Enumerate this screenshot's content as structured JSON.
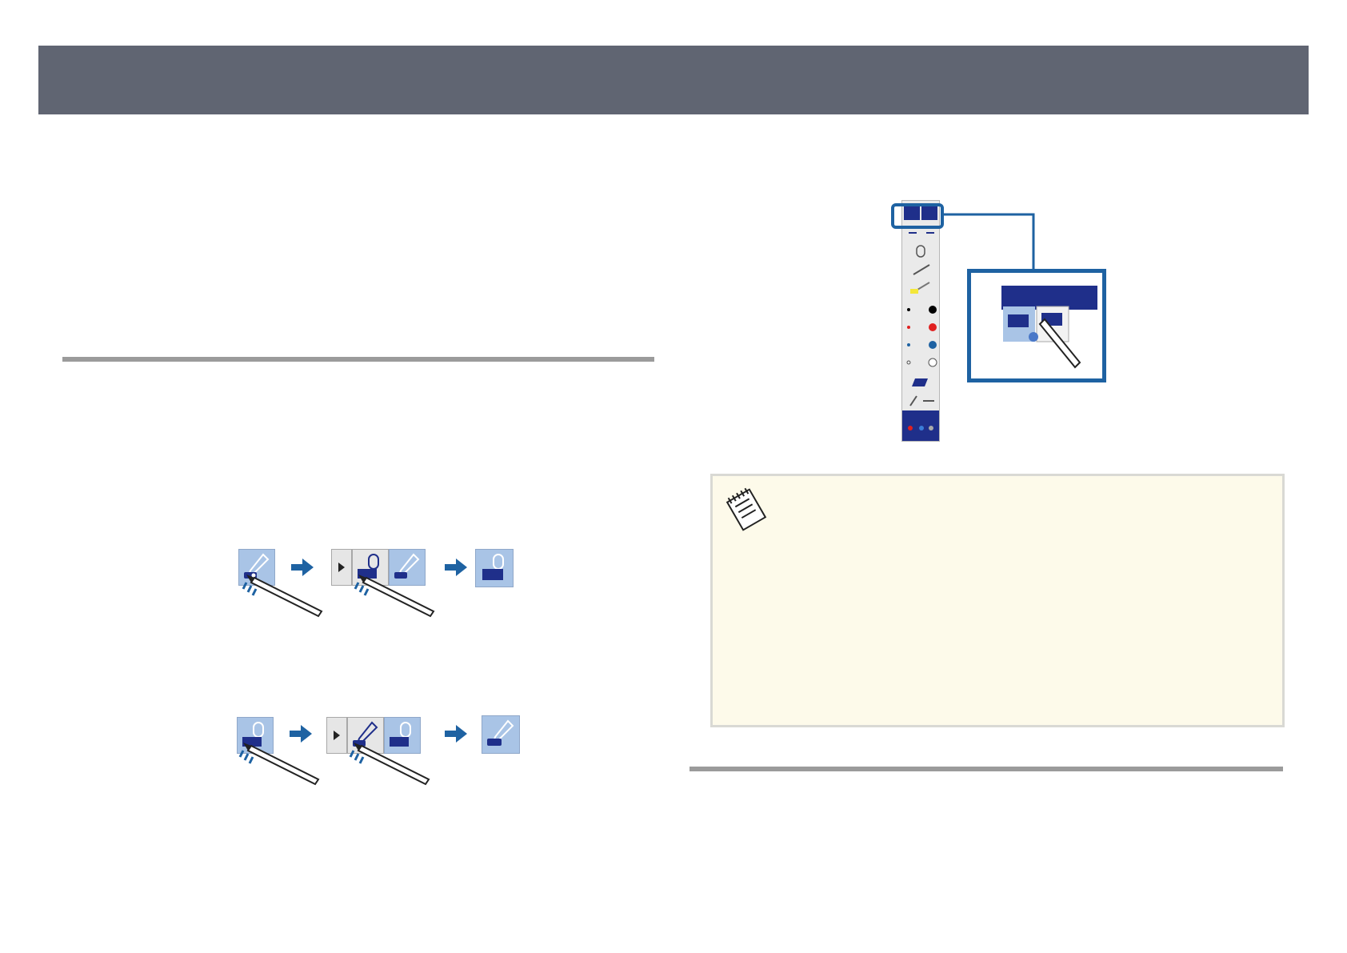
{
  "page": {
    "header_title": "",
    "colors": {
      "header": "#606572",
      "rule": "#9b9b9b",
      "icon_fill": "#a9c4e6",
      "icon_dark": "#1f2f8a",
      "accent_blue": "#1e62a2",
      "note_bg": "#fdfaea"
    }
  },
  "figures": {
    "pen_to_mouse": {
      "steps": [
        "pen-mode-icon",
        "mode-switch-menu",
        "mouse-mode-icon"
      ]
    },
    "mouse_to_pen": {
      "steps": [
        "mouse-mode-icon",
        "mode-switch-menu",
        "pen-mode-icon"
      ]
    },
    "toolbar_callout": {
      "highlight_icon": "mode-switch-buttons"
    }
  },
  "note": {
    "icon": "notepad-icon"
  }
}
